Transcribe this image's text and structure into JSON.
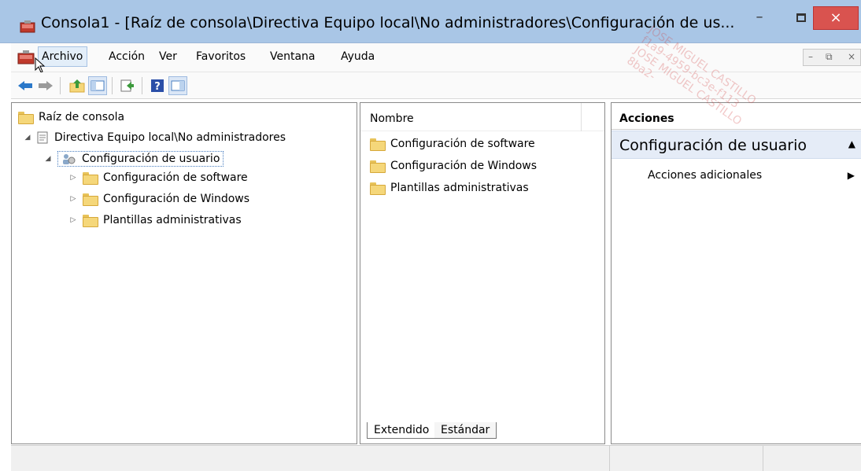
{
  "window": {
    "title": "Consola1 - [Raíz de consola\\Directiva Equipo local\\No administradores\\Configuración de us...",
    "min_label": "–",
    "close_label": "×"
  },
  "menu": {
    "items": [
      "Archivo",
      "Acción",
      "Ver",
      "Favoritos",
      "Ventana",
      "Ayuda"
    ],
    "mdi": {
      "min": "–",
      "restore": "⧉",
      "close": "×"
    }
  },
  "tree": {
    "root": "Raíz de consola",
    "policy": "Directiva Equipo local\\No administradores",
    "user_config": "Configuración de usuario",
    "children": [
      "Configuración de software",
      "Configuración de Windows",
      "Plantillas administrativas"
    ]
  },
  "list": {
    "column_name": "Nombre",
    "items": [
      "Configuración de software",
      "Configuración de Windows",
      "Plantillas administrativas"
    ],
    "tabs": [
      "Extendido",
      "Estándar"
    ]
  },
  "actions": {
    "header": "Acciones",
    "section_title": "Configuración de usuario",
    "item": "Acciones adicionales"
  },
  "watermark": {
    "lines": [
      "JOSE MIGUEL CASTILLO",
      "f1a9-4959-bc3e-f113",
      "JOSE MIGUEL CASTILLO",
      "8ba2-"
    ]
  },
  "colors": {
    "title_bar": "#a9c6e6",
    "close_button": "#d9534f",
    "selection_bg": "#e5ecf7",
    "folder": "#f5d77a"
  }
}
